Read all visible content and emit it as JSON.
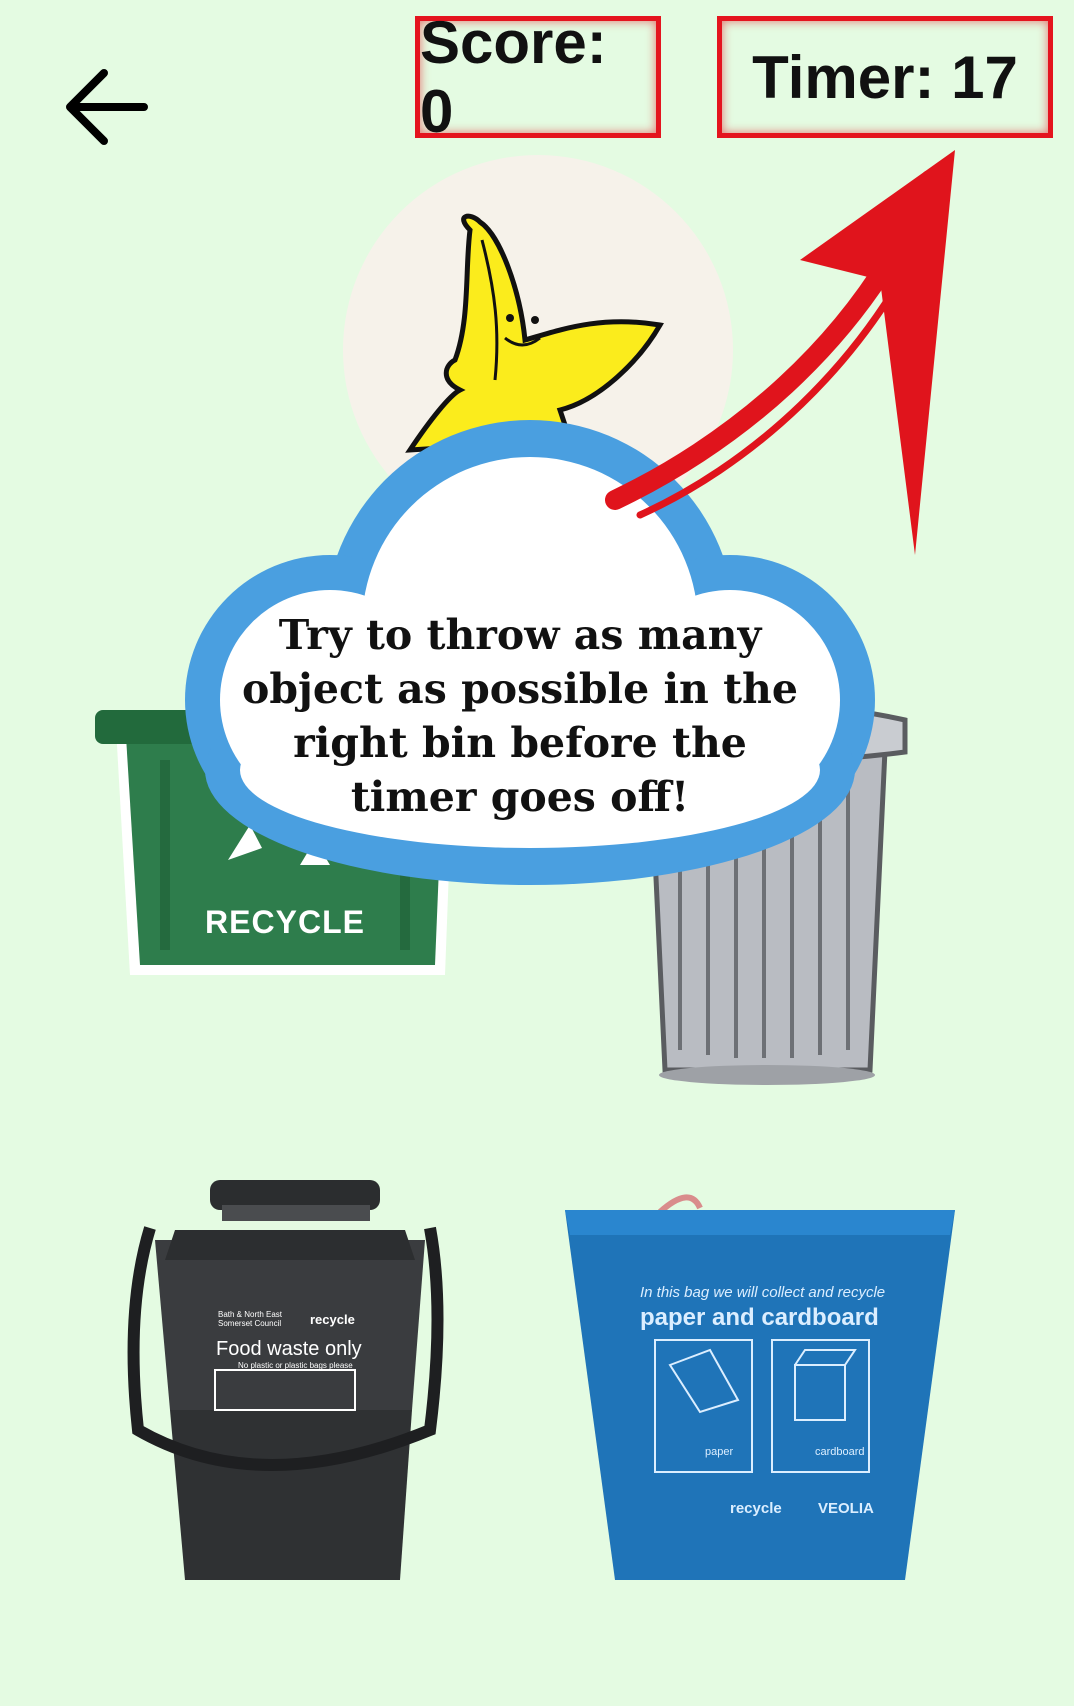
{
  "hud": {
    "score_label": "Score: 0",
    "timer_label": "Timer: 17"
  },
  "current_item": {
    "icon": "banana-peel-icon"
  },
  "tutorial": {
    "message": "Try to throw as many object as possible in the right bin before the timer goes off!"
  },
  "bins": {
    "recycle": {
      "label": "RECYCLE"
    },
    "general": {
      "icon": "trash-can-icon"
    },
    "food": {
      "council": "Bath & North East Somerset Council",
      "brand": "recycle",
      "title": "Food waste only",
      "subtitle": "No plastic or plastic bags please"
    },
    "paper": {
      "line1": "In this bag we will collect and recycle",
      "title": "paper and cardboard",
      "item1": "paper",
      "item2": "cardboard",
      "brand1": "recycle",
      "brand2": "VEOLIA"
    }
  },
  "colors": {
    "background": "#e4fbe2",
    "hud_border": "#e4141e",
    "arrow": "#e0141c",
    "cloud_border": "#4a9fe0",
    "recycle_bin": "#2e7d4c",
    "bag": "#1f74b8"
  }
}
